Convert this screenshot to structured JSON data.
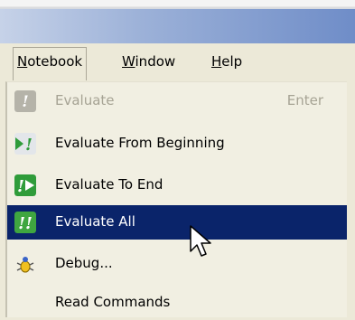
{
  "menubar": {
    "items": [
      {
        "label": "Notebook",
        "mnemonic": "N"
      },
      {
        "label": "Window",
        "mnemonic": "W"
      },
      {
        "label": "Help",
        "mnemonic": "H"
      }
    ]
  },
  "menu": {
    "items": [
      {
        "label": "Evaluate",
        "shortcut": "Enter",
        "state": "disabled",
        "icon": "evaluate-icon"
      },
      {
        "label": "Evaluate From Beginning",
        "icon": "evaluate-from-beginning-icon"
      },
      {
        "label": "Evaluate To End",
        "icon": "evaluate-to-end-icon"
      },
      {
        "label": "Evaluate All",
        "state": "selected",
        "icon": "evaluate-all-icon"
      },
      {
        "label": "Debug...",
        "icon": "debug-icon"
      },
      {
        "label": "Read Commands"
      }
    ]
  },
  "colors": {
    "selection": "#0a246a",
    "menu_bg": "#f1efe2",
    "icon_green": "#2f9c3a"
  }
}
